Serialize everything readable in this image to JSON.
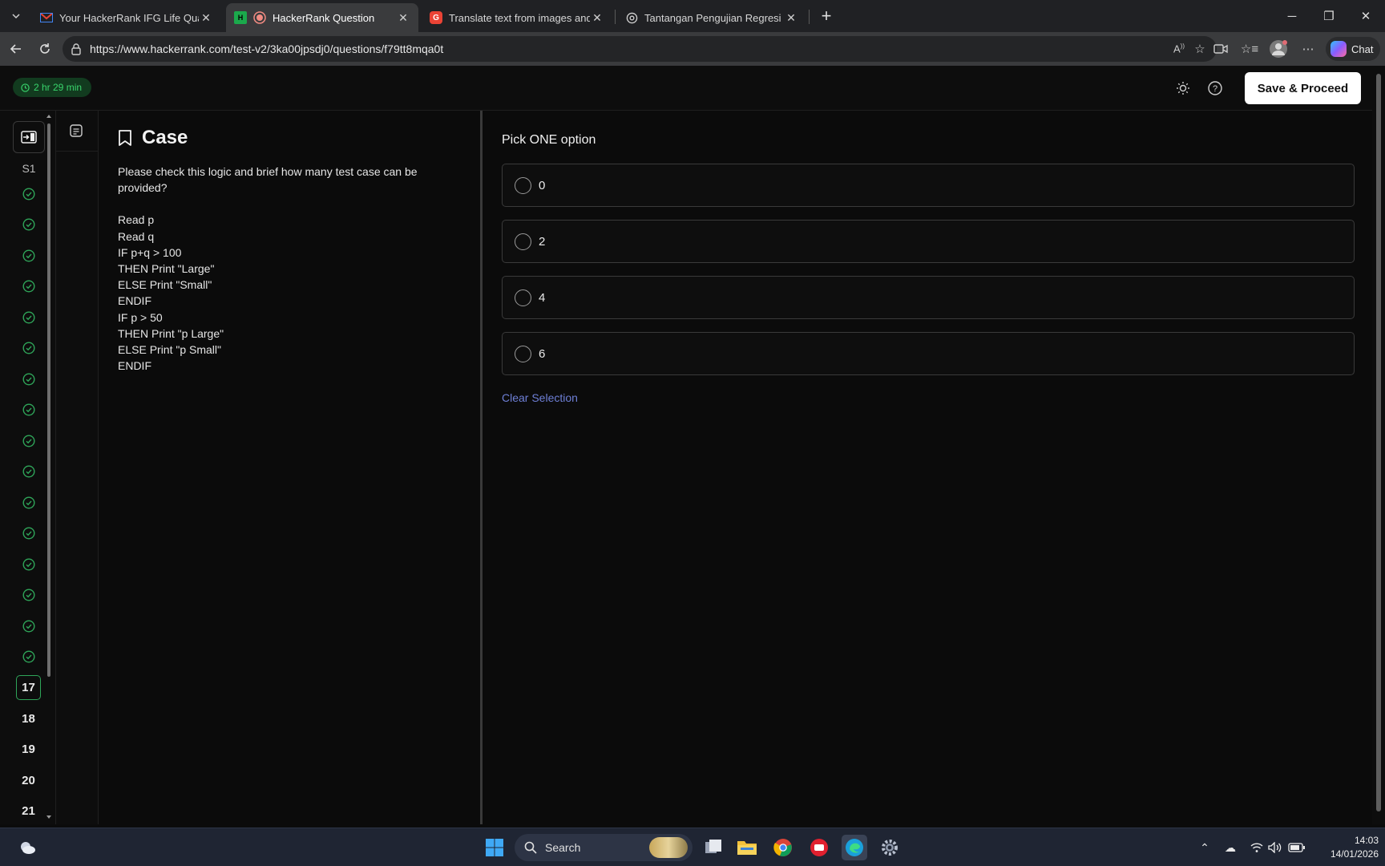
{
  "browser": {
    "tabs": [
      {
        "title": "Your HackerRank IFG Life Quality A",
        "favicon": "gmail-icon",
        "active": false
      },
      {
        "title": "HackerRank Question",
        "favicon": "hackerrank-icon",
        "active": true
      },
      {
        "title": "Translate text from images and ph",
        "favicon": "translate-icon",
        "active": false
      },
      {
        "title": "Tantangan Pengujian Regresi",
        "favicon": "chatgpt-icon",
        "active": false
      }
    ],
    "url": "https://www.hackerrank.com/test-v2/3ka00jpsdj0/questions/f79tt8mqa0t",
    "chat_label": "Chat"
  },
  "header": {
    "timer": "2 hr 29 min",
    "save_label": "Save & Proceed"
  },
  "sidebar": {
    "section_label": "S1",
    "completed_count": 16,
    "current": "17",
    "upcoming": [
      "18",
      "19",
      "20",
      "21"
    ]
  },
  "question": {
    "title": "Case",
    "prompt": "Please check this logic and brief how many test case can be provided?",
    "code_lines": [
      "Read p",
      "Read q",
      "IF p+q > 100",
      "THEN Print \"Large\"",
      "ELSE Print \"Small\"",
      "ENDIF",
      "IF p > 50",
      "THEN Print \"p Large\"",
      "ELSE Print \"p Small\"",
      "ENDIF"
    ]
  },
  "answers": {
    "instruction": "Pick ONE option",
    "options": [
      "0",
      "2",
      "4",
      "6"
    ],
    "selected": null,
    "clear_label": "Clear Selection"
  },
  "taskbar": {
    "search_placeholder": "Search",
    "time": "14:03",
    "date": "14/01/2026"
  },
  "colors": {
    "accent_green": "#2fa559",
    "link_blue": "#6e7fd6",
    "background": "#0b0b0b"
  }
}
